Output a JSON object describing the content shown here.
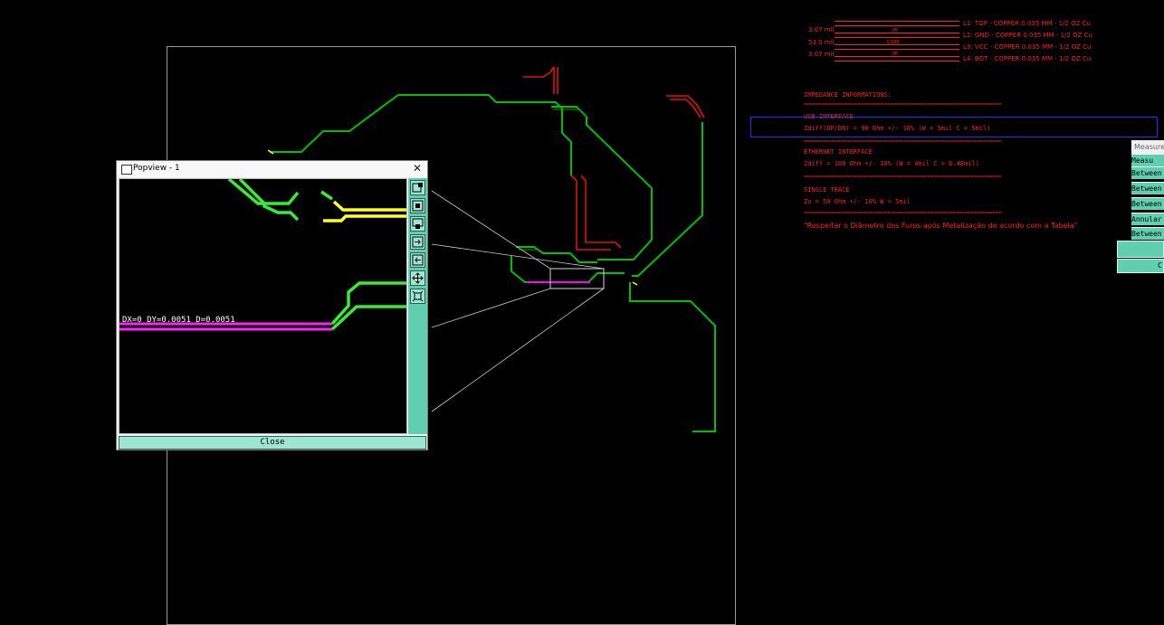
{
  "stackup": {
    "layers": [
      {
        "thickness": "3.07 mil",
        "bar_label": "PP",
        "name": "L1: TOP - COPPER 0.035 MM - 1/2 OZ Cu"
      },
      {
        "thickness": "",
        "bar_label": "",
        "name": "L2: GND - COPPER 0.035 MM - 1/2 OZ Cu"
      },
      {
        "thickness": "53.0 mil",
        "bar_label": "CORE",
        "name": "L3: VCC - COPPER 0.035 MM - 1/2 OZ Cu"
      },
      {
        "thickness": "3.07 mil",
        "bar_label": "PP",
        "name": "L4: BOT - COPPER 0.035 MM - 1/2 OZ Cu"
      }
    ]
  },
  "impedance": {
    "header": "IMPEDANCE INFORMATIONS:",
    "separator": "================================================================",
    "usb_title": "USB INTERFACE",
    "usb_value": "Zdiff(DP/DN) = 90 Ohm +/- 10% (W = 5mil   C = 5mil)",
    "eth_title": "ETHERNET INTERFACE",
    "eth_value": "Zdiff = 100 Ohm +/- 10% (W = 4mil   C = 6.48mil)",
    "single_title": "SINGLE TRACE",
    "single_value": "Zo = 50 Ohm +/- 10%      W = 5mil",
    "note": "\"Respeitar o Diâmetro dos Furos após Metalização de acordo com a Tabela\""
  },
  "measure_panel": {
    "title": "Measure",
    "rows": [
      "Measu",
      "Between",
      "Between",
      "Between",
      "Annular",
      "Between"
    ],
    "close_label": "Cl"
  },
  "popview": {
    "title": "Popview - 1",
    "close_label": "Close",
    "readout": "DX=0 DY=0.0051 D=0.0051",
    "tools": [
      "zoom-in-icon",
      "zoom-out-icon",
      "zoom-window-icon",
      "fit-in-icon",
      "fit-out-icon",
      "pan-icon",
      "zoom-fit-all-icon"
    ]
  },
  "colors": {
    "background": "#000000",
    "trace_green": "#00c800",
    "trace_bright_green": "#39ff14",
    "trace_red": "#e01010",
    "trace_magenta": "#ff00ff",
    "trace_yellow": "#ffff00",
    "toolbar_teal": "#5fcfb0",
    "selection_blue": "#2030ff"
  }
}
